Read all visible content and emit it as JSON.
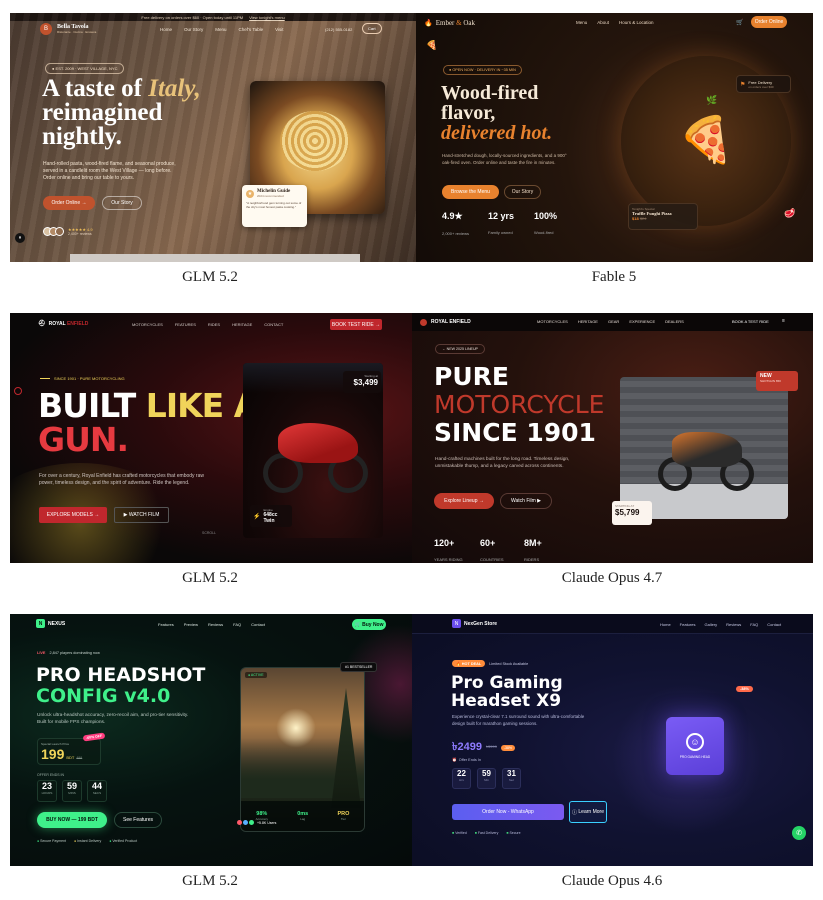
{
  "captions": {
    "p1": "GLM 5.2",
    "p2": "Fable 5",
    "p3": "GLM 5.2",
    "p4": "Claude Opus 4.7",
    "p5": "GLM 5.2",
    "p6": "Claude Opus 4.6"
  },
  "p1": {
    "topbar": "Free delivery on orders over $60 · Open today until 11PM",
    "topbar_link": "View tonight's menu",
    "brand": "Bella Tavola",
    "brand_sub": "Ristorante · Cucina · Enoteca",
    "nav": [
      "Home",
      "Our Story",
      "Menu",
      "Chef's Table",
      "Visit"
    ],
    "phone": "(212) 555-0182",
    "cart": "Cart",
    "badge": "● EST. 2009 · WEST VILLAGE, NYC",
    "h1a": "A taste of ",
    "h1b": "Italy,",
    "h1c": "reimagined",
    "h1d": "nightly.",
    "lead": "Hand-rolled pasta, wood-fired flame, and seasonal produce, served in a candlelit room the West Village — long before. Order online and bring our table to yours.",
    "cta1": "Order Online →",
    "cta2": "Our Story",
    "rating": "★★★★★ 4.9",
    "rating_sub": "2,400+ reviews",
    "card_title": "Michelin Guide",
    "card_sub": "2024 recommended",
    "card_quote": "\"A neighborhood gem turning out some of the city's most honest pasta cooking.\""
  },
  "p2": {
    "brand_a": "Ember ",
    "brand_b": "&",
    "brand_c": " Oak",
    "nav": [
      "Menu",
      "About",
      "Hours & Location"
    ],
    "order": "Order Online",
    "badge": "● OPEN NOW · DELIVERY IN ~35 MIN",
    "h1a": "Wood-fired",
    "h1b": "flavor,",
    "h1c": "delivered hot.",
    "lead": "Hand-stretched dough, locally-sourced ingredients, and a 900° oak-fired oven. Order online and taste the fire in minutes.",
    "cta1": "Browse the Menu",
    "cta2": "Our Story",
    "stats": [
      {
        "v": "4.9★",
        "l": "2,000+ reviews"
      },
      {
        "v": "12 yrs",
        "l": "Family owned"
      },
      {
        "v": "100%",
        "l": "Wood-fired"
      }
    ],
    "delivery": "Free Delivery",
    "delivery_sub": "on orders over $30",
    "tonight_label": "Tonight's Special",
    "tonight_name": "Truffle Funghi Pizza",
    "tonight_price": "$18",
    "tonight_old": "$24"
  },
  "p3": {
    "brand_a": "ROYAL ",
    "brand_b": "ENFIELD",
    "nav": [
      "MOTORCYCLES",
      "FEATURES",
      "RIDES",
      "HERITAGE",
      "CONTACT"
    ],
    "book": "BOOK TEST RIDE →",
    "since": "SINCE 1901 · PURE MOTORCYCLING",
    "h1a": "BUILT ",
    "h1b": "LIKE A",
    "h1c": "GUN.",
    "lead": "For over a century, Royal Enfield has crafted motorcycles that embody raw power, timeless design, and the spirit of adventure. Ride the legend.",
    "cta1": "EXPLORE MODELS →",
    "cta2": "▶ WATCH FILM",
    "price_label": "Starting at",
    "price": "$3,499",
    "engine_label": "Engine",
    "engine": "648cc Twin",
    "scroll": "SCROLL"
  },
  "p4": {
    "brand": "ROYAL ENFIELD",
    "nav": [
      "MOTORCYCLES",
      "HERITAGE",
      "GEAR",
      "EXPERIENCE",
      "DEALERS"
    ],
    "book": "BOOK A TEST RIDE",
    "pill": "← NEW 2025 LINEUP",
    "h1a": "PURE",
    "h1b": "MOTORCYCLE",
    "h1c": "SINCE 1901",
    "lead": "Hand-crafted machines built for the long road. Timeless design, unmistakable thump, and a legacy carved across continents.",
    "cta1": "Explore Lineup →",
    "cta2": "Watch Film ▶",
    "new": "NEW",
    "new_sub": "SHOTGUN 650",
    "price_label": "STARTING AT",
    "price": "$5,799",
    "stats": [
      {
        "v": "120+",
        "l": "YEARS RIDING"
      },
      {
        "v": "60+",
        "l": "COUNTRIES"
      },
      {
        "v": "8M+",
        "l": "RIDERS"
      }
    ]
  },
  "p5": {
    "brand": "NEXUS",
    "nav": [
      "Features",
      "Preview",
      "Reviews",
      "FAQ",
      "Contact"
    ],
    "buy": "Buy Now",
    "live": "LIVE",
    "live_sub": "2,847 players dominating now",
    "h1a": "PRO HEADSHOT",
    "h1b": "CONFIG v4.0",
    "lead": "Unlock ultra-headshot accuracy, zero-recoil aim, and pro-tier sensitivity. Built for mobile FPS champions.",
    "price_label": "Special Launch Price",
    "price": "199",
    "currency": "BDT",
    "old": "499",
    "off": "-60% OFF",
    "timer_label": "OFFER ENDS IN",
    "timer": [
      {
        "v": "23",
        "l": "HOURS"
      },
      {
        "v": "59",
        "l": "MINS"
      },
      {
        "v": "44",
        "l": "SECS"
      }
    ],
    "cta1": "BUY NOW — 199 BDT",
    "cta2": "See Features",
    "trust": [
      "Secure Payment",
      "Instant Delivery",
      "Verified Product"
    ],
    "tag_active": "● ACTIVE",
    "tag_best": "#1 BESTSELLER",
    "metrics": [
      {
        "v": "98%",
        "l": "Accuracy"
      },
      {
        "v": "0ms",
        "l": "Lag"
      },
      {
        "v": "PRO",
        "l": "Tier"
      }
    ],
    "users": "+5.8K Users"
  },
  "p6": {
    "brand": "NexGen Store",
    "nav": [
      "Home",
      "Features",
      "Gallery",
      "Reviews",
      "FAQ",
      "Contact"
    ],
    "badge": "🔥 HOT DEAL",
    "badge_sub": "Limited Stock Available",
    "h1a": "Pro Gaming",
    "h1b": "Headset X9",
    "lead": "Experience crystal-clear 7.1 surround sound with ultra-comfortable design built for marathon gaming sessions.",
    "price": "৳2499",
    "old": "৳3999",
    "off": "-38%",
    "offer": "Offer Ends In",
    "timer": [
      {
        "v": "22",
        "l": "Hrs"
      },
      {
        "v": "59",
        "l": "Min"
      },
      {
        "v": "31",
        "l": "Sec"
      }
    ],
    "cta1": "Order Now - WhatsApp",
    "cta2": "Learn More",
    "trust": [
      "Verified",
      "Fast Delivery",
      "Secure"
    ],
    "product": "PRO GAMING HEAD",
    "discount": "-38%"
  },
  "colors": {
    "p1_bg": "#3a2a20",
    "p2_bg": "#140d09",
    "p2_accent": "#e8822e",
    "p3_bg": "#0a0808",
    "p3_red": "#c0272d",
    "p3_yellow": "#f0d45a",
    "p4_bg": "#1a0f0d",
    "p4_red": "#c0392b",
    "p5_bg": "#050a0a",
    "p5_green": "#3ff08a",
    "p6_bg": "#0b0d22",
    "p6_purple": "#6b4ef0"
  }
}
